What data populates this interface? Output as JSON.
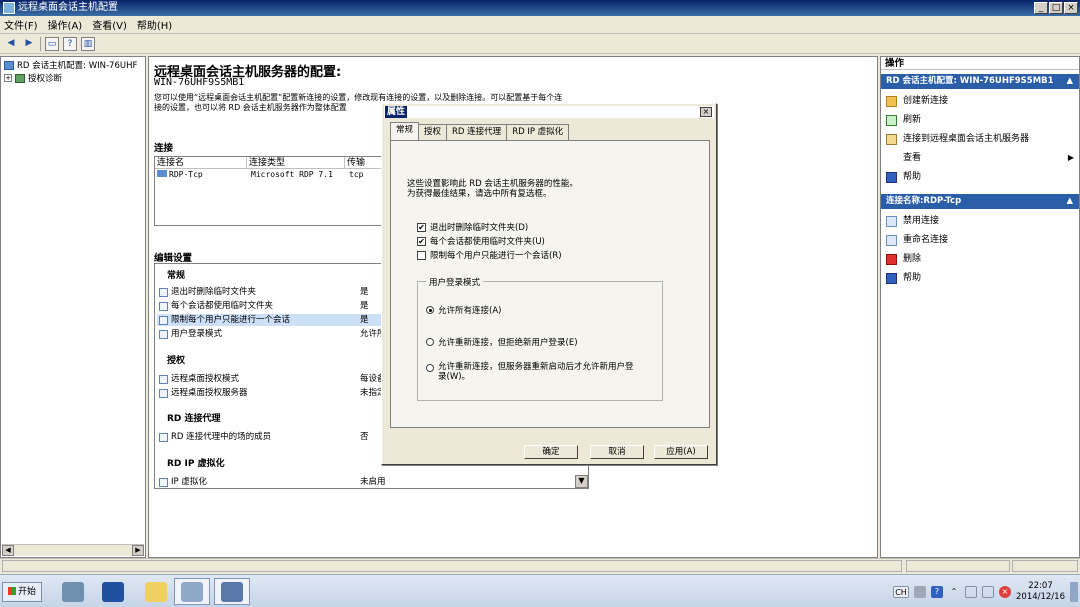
{
  "window": {
    "title": "远程桌面会话主机配置",
    "btn_min": "_",
    "btn_max": "□",
    "btn_close": "×"
  },
  "menu": [
    "文件(F)",
    "操作(A)",
    "查看(V)",
    "帮助(H)"
  ],
  "toolbar": {
    "back": "◀",
    "forward": "▶"
  },
  "tree": {
    "root": "RD 会话主机配置: WIN-76UHF",
    "child": "授权诊断",
    "expand": "+",
    "scroll_left": "◀",
    "scroll_right": "▶"
  },
  "main": {
    "title": "远程桌面会话主机服务器的配置:",
    "server": "WIN-76UHF9S5MB1",
    "desc_line1": "您可以使用“远程桌面会话主机配置”配置新连接的设置，修改现有连接的设置，以及删除连接。可以配置基于每个连",
    "desc_line2": "接的设置，也可以将 RD 会话主机服务器作为整体配置",
    "connections_header": "连接",
    "columns": [
      "连接名",
      "连接类型",
      "传输"
    ],
    "rows": [
      [
        "RDP-Tcp",
        "Microsoft RDP 7.1",
        "tcp"
      ]
    ],
    "edit_header": "编辑设置",
    "groups": {
      "general": "常规",
      "licensing": "授权",
      "broker": "RD 连接代理",
      "ipvirt": "RD IP 虚拟化"
    },
    "settings": {
      "general": [
        {
          "name": "退出时删除临时文件夹",
          "value": "是"
        },
        {
          "name": "每个会话都使用临时文件夹",
          "value": "是"
        },
        {
          "name": "限制每个用户只能进行一个会话",
          "value": "是"
        },
        {
          "name": "用户登录模式",
          "value": "允许所"
        }
      ],
      "licensing": [
        {
          "name": "远程桌面授权模式",
          "value": "每设备"
        },
        {
          "name": "远程桌面授权服务器",
          "value": "未指定"
        }
      ],
      "broker": [
        {
          "name": "RD 连接代理中的场的成员",
          "value": "否"
        }
      ],
      "ipvirt": [
        {
          "name": "IP 虚拟化",
          "value": "未启用"
        }
      ]
    },
    "scroll_down": "▼"
  },
  "dialog": {
    "title": "属性",
    "close": "×",
    "tabs": [
      "常规",
      "授权",
      "RD 连接代理",
      "RD IP 虚拟化"
    ],
    "info_line1": "这些设置影响此 RD 会话主机服务器的性能。",
    "info_line2": "为获得最佳结果，请选中所有复选框。",
    "check_mark": "✔",
    "checkboxes": [
      {
        "label": "退出时删除临时文件夹(D)",
        "checked": true
      },
      {
        "label": "每个会话都使用临时文件夹(U)",
        "checked": true
      },
      {
        "label": "限制每个用户只能进行一个会话(R)",
        "checked": false
      }
    ],
    "login_group": "用户登录模式",
    "radios": [
      {
        "label": "允许所有连接(A)",
        "selected": true
      },
      {
        "label": "允许重新连接，但拒绝新用户登录(E)",
        "selected": false
      },
      {
        "label_line1": "允许重新连接，但服务器重新启动后才允许新用户登",
        "label_line2": "录(W)。",
        "selected": false
      }
    ],
    "buttons": {
      "ok": "确定",
      "cancel": "取消",
      "apply": "应用(A)"
    }
  },
  "actions": {
    "title": "操作",
    "section1": "RD 会话主机配置: WIN-76UHF9S5MB1",
    "section1_items": [
      "创建新连接",
      "刷新",
      "连接到远程桌面会话主机服务器",
      "查看",
      "帮助"
    ],
    "submenu_arrow": "▶",
    "section2": "连接名称:RDP-Tcp",
    "section2_items": [
      "禁用连接",
      "重命名连接",
      "删除",
      "帮助"
    ],
    "collapse": "▲"
  },
  "taskbar": {
    "start": "开始",
    "lang": "CH",
    "time": "22:07",
    "date": "2014/12/16"
  }
}
